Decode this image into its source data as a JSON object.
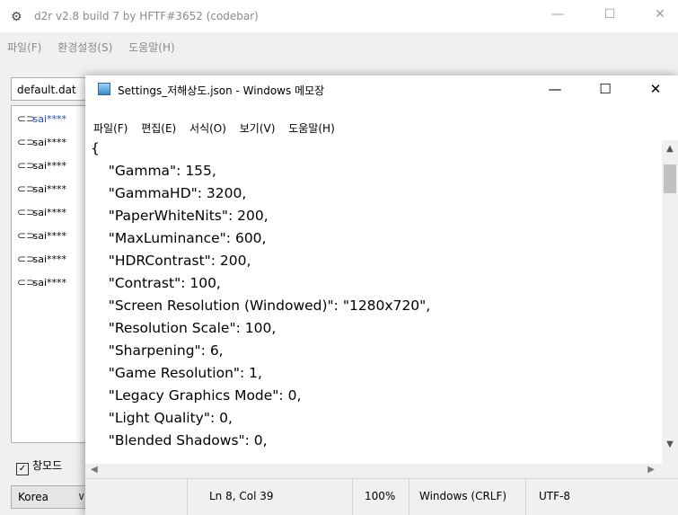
{
  "background_window": {
    "title": "d2r v2.8 build 7 by HFTF#3652 (codebar)",
    "menu": [
      "파일(F)",
      "환경설정(S)",
      "도움말(H)"
    ],
    "profile_value": "default.dat",
    "accounts": [
      "sai****",
      "sai****",
      "sai****",
      "sai****",
      "sai****",
      "sai****",
      "sai****",
      "sai****"
    ],
    "windowed_checkbox": {
      "label": "창모드",
      "checked": true
    },
    "region_value": "Korea"
  },
  "notepad": {
    "title": "Settings_저해상도.json - Windows 메모장",
    "menu": [
      "파일(F)",
      "편집(E)",
      "서식(O)",
      "보기(V)",
      "도움말(H)"
    ],
    "content_lines": [
      "{",
      "    \"Gamma\": 155,",
      "    \"GammaHD\": 3200,",
      "    \"PaperWhiteNits\": 200,",
      "    \"MaxLuminance\": 600,",
      "    \"HDRContrast\": 200,",
      "    \"Contrast\": 100,",
      "    \"Screen Resolution (Windowed)\": \"1280x720\",",
      "    \"Resolution Scale\": 100,",
      "    \"Sharpening\": 6,",
      "    \"Game Resolution\": 1,",
      "    \"Legacy Graphics Mode\": 0,",
      "    \"Light Quality\": 0,",
      "    \"Blended Shadows\": 0,"
    ],
    "status": {
      "position": "Ln 8, Col 39",
      "zoom": "100%",
      "line_ending": "Windows (CRLF)",
      "encoding": "UTF-8"
    }
  },
  "icons": {
    "minimize": "—",
    "maximize": "☐",
    "close": "✕",
    "scroll_up": "▲",
    "scroll_down": "▼",
    "scroll_left": "◀",
    "scroll_right": "▶"
  }
}
